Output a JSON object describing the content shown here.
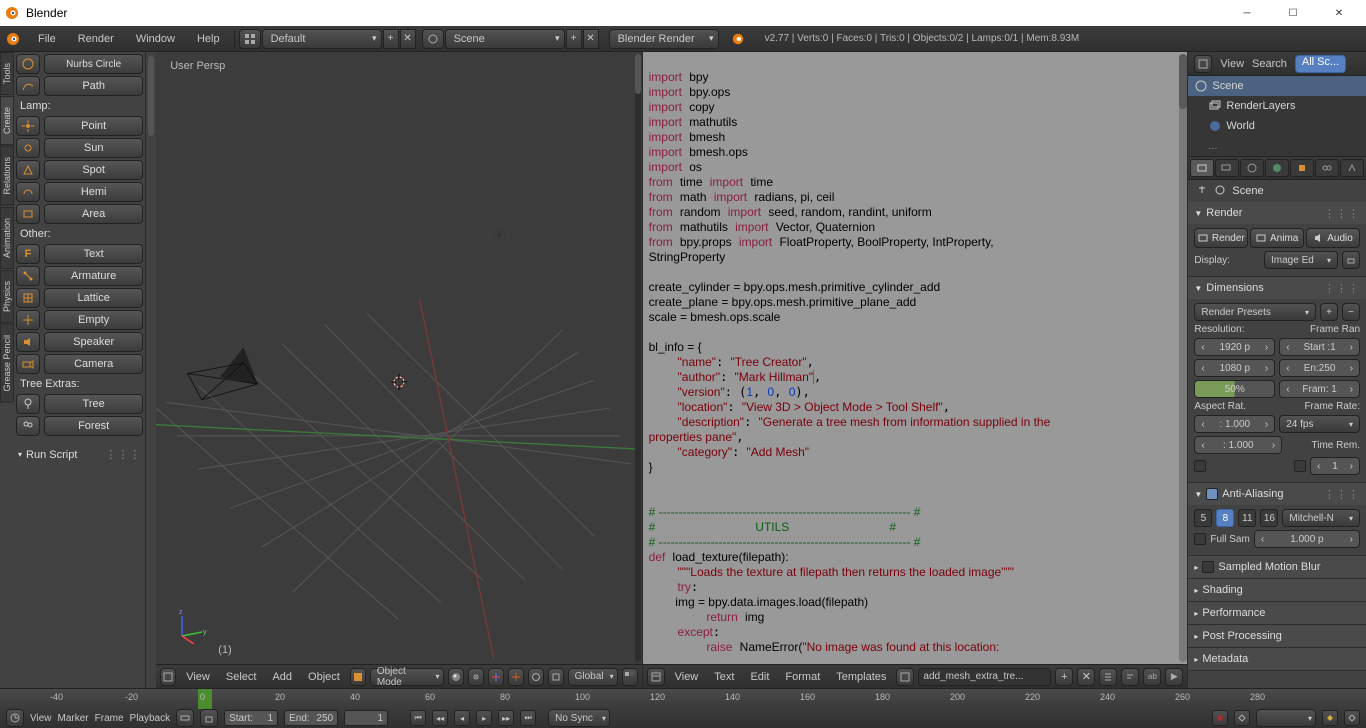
{
  "title": "Blender",
  "topmenu": {
    "file": "File",
    "render": "Render",
    "window": "Window",
    "help": "Help",
    "layout": "Default",
    "scene": "Scene",
    "engine": "Blender Render",
    "stats": "v2.77 | Verts:0 | Faces:0 | Tris:0 | Objects:0/2 | Lamps:0/1 | Mem:8.93M"
  },
  "toolshelf": {
    "top0": "Nurbs Circle",
    "top1": "Path",
    "lamp_label": "Lamp:",
    "lamp": [
      "Point",
      "Sun",
      "Spot",
      "Hemi",
      "Area"
    ],
    "other_label": "Other:",
    "other": [
      "Text",
      "Armature",
      "Lattice",
      "Empty",
      "Speaker",
      "Camera"
    ],
    "tree_label": "Tree Extras:",
    "tree": [
      "Tree",
      "Forest"
    ],
    "runscript": "Run Script"
  },
  "rail": [
    "Tools",
    "Create",
    "Relations",
    "Animation",
    "Physics",
    "Grease Pencil"
  ],
  "vp3d": {
    "label": "User Persp",
    "bottom_num": "(1)",
    "menu": {
      "view": "View",
      "select": "Select",
      "add": "Add",
      "object": "Object"
    },
    "mode": "Object Mode",
    "orient": "Global"
  },
  "text": {
    "menu": {
      "view": "View",
      "text": "Text",
      "edit": "Edit",
      "format": "Format",
      "templates": "Templates"
    },
    "file": "add_mesh_extra_tre..."
  },
  "outliner_head": {
    "view": "View",
    "search": "Search",
    "all": "All Sc..."
  },
  "outliner": {
    "scene": "Scene",
    "rl": "RenderLayers",
    "world": "World"
  },
  "props": {
    "crumb_scene": "Scene",
    "render": "Render",
    "render_btns": [
      "Render",
      "Anima",
      "Audio"
    ],
    "display_label": "Display:",
    "display": "Image Ed",
    "dimensions": "Dimensions",
    "render_presets": "Render Presets",
    "res_label": "Resolution:",
    "frame_range": "Frame Ran",
    "resx": "1920 p",
    "resy": "1080 p",
    "pct": "50%",
    "start": "Start :1",
    "end": "En:250",
    "fram": "Fram: 1",
    "aspect": "Aspect Rat.",
    "framerate": "Frame Rate:",
    "ax": ": 1.000",
    "ay": ": 1.000",
    "fps": "24 fps",
    "timer": "Time Rem.",
    "frame1": "1",
    "aa": "Anti-Aliasing",
    "aa_nums": [
      "5",
      "8",
      "11",
      "16"
    ],
    "aa_filter": "Mitchell-N",
    "fullsample": "Full Sam",
    "aasize": "1.000 p",
    "smb": "Sampled Motion Blur",
    "shading": "Shading",
    "perf": "Performance",
    "post": "Post Processing",
    "meta": "Metadata"
  },
  "timeline": {
    "ticks": [
      "-40",
      "-20",
      "0",
      "20",
      "40",
      "60",
      "80",
      "100",
      "120",
      "140",
      "160",
      "180",
      "200",
      "220",
      "240",
      "260",
      "280"
    ],
    "menu": {
      "view": "View",
      "marker": "Marker",
      "frame": "Frame",
      "playback": "Playback"
    },
    "start_lbl": "Start:",
    "start": "1",
    "end_lbl": "End:",
    "end": "250",
    "curr": "1",
    "nosync": "No Sync"
  },
  "code": {
    "l1_kw": "import",
    "l1_m": "bpy",
    "l2_kw": "import",
    "l2_m": "bpy.ops",
    "l3_kw": "import",
    "l3_m": "copy",
    "l4_kw": "import",
    "l4_m": "mathutils",
    "l5_kw": "import",
    "l5_m": "bmesh",
    "l6_kw": "import",
    "l6_m": "bmesh.ops",
    "l7_kw": "import",
    "l7_m": "os",
    "l8_a": "from",
    "l8_b": "time",
    "l8_c": "import",
    "l8_d": "time",
    "l9_a": "from",
    "l9_b": "math",
    "l9_c": "import",
    "l9_d": "radians, pi, ceil",
    "l10_a": "from",
    "l10_b": "random",
    "l10_c": "import",
    "l10_d": "seed, random, randint, uniform",
    "l11_a": "from",
    "l11_b": "mathutils",
    "l11_c": "import",
    "l11_d": "Vector, Quaternion",
    "l12_a": "from",
    "l12_b": "bpy.props",
    "l12_c": "import",
    "l12_d": "FloatProperty, BoolProperty, IntProperty, ",
    "l12e": "StringProperty",
    "l14": "create_cylinder = bpy.ops.mesh.primitive_cylinder_add",
    "l15": "create_plane = bpy.ops.mesh.primitive_plane_add",
    "l16": "scale = bmesh.ops.scale",
    "l18": "bl_info = {",
    "l19k": "\"name\"",
    "l19v": "\"Tree Creator\"",
    "l20k": "\"author\"",
    "l20v": "\"Mark Hillman\"",
    "l21k": "\"version\"",
    "l21a": "1",
    "l21b": "0",
    "l21c": "0",
    "l22k": "\"location\"",
    "l22v": "\"View 3D > Object Mode > Tool Shelf\"",
    "l23k": "\"description\"",
    "l23v": "\"Generate a tree mesh from information supplied in the ",
    "l23v2": "properties pane\"",
    "l24k": "\"category\"",
    "l24v": "\"Add Mesh\"",
    "l25": "}",
    "c1": "# --------------------------------------------------------------- #",
    "c2": "#                              UTILS                              #",
    "c3": "# --------------------------------------------------------------- #",
    "d1a": "def",
    "d1b": "load_texture(filepath):",
    "d2": "\"\"\"Loads the texture at filepath then returns the loaded image\"\"\"",
    "d3": "try",
    "d4": "        img = bpy.data.images.load(filepath)",
    "d5a": "return",
    "d5b": "img",
    "d6": "except",
    "d7a": "raise",
    "d7b": "NameError(",
    "d7c": "\"No image was found at this location: "
  }
}
